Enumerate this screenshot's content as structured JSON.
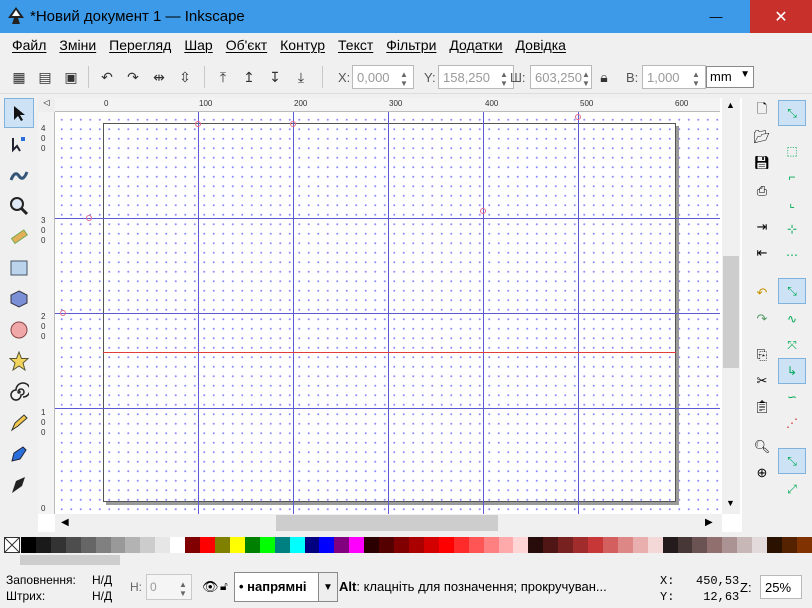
{
  "window": {
    "title": "*Новий документ 1 — Inkscape",
    "close_icon": "✕",
    "max_icon": "□",
    "min_icon": "—"
  },
  "menu": [
    {
      "label": "Файл"
    },
    {
      "label": "Зміни"
    },
    {
      "label": "Перегляд"
    },
    {
      "label": "Шар"
    },
    {
      "label": "Об'єкт"
    },
    {
      "label": "Контур"
    },
    {
      "label": "Текст"
    },
    {
      "label": "Фільтри"
    },
    {
      "label": "Додатки"
    },
    {
      "label": "Довідка"
    }
  ],
  "toolbar": {
    "x_label": "X:",
    "x_value": "0,000",
    "y_label": "Y:",
    "y_value": "158,250",
    "w_label": "Ш:",
    "w_value": "603,250",
    "h_label": "В:",
    "h_value": "1,000",
    "unit": "mm"
  },
  "ruler": {
    "top": [
      "0",
      "100",
      "200",
      "300",
      "400",
      "500",
      "600"
    ],
    "left": [
      "4",
      "0",
      "0",
      "3",
      "0",
      "0",
      "2",
      "0",
      "0",
      "1",
      "0",
      "0",
      "0"
    ]
  },
  "status": {
    "fill_label": "Заповнення:",
    "fill_value": "Н/Д",
    "stroke_label": "Штрих:",
    "stroke_value": "Н/Д",
    "h_label": "Н:",
    "h_value": "0",
    "layer": "напрямні",
    "message_key": "Alt",
    "message": ": клацніть для позначення; прокручуван...",
    "x_label": "X:",
    "x_value": "450,53",
    "y_label": "Y:",
    "y_value": "12,63",
    "zoom_label": "Z:",
    "zoom_value": "25%"
  },
  "colors": {
    "accent": "#3c9ae8",
    "close": "#c7302b",
    "guide": "#5b5bd6",
    "guide_selected": "#e43b3b"
  },
  "palette": [
    "#000000",
    "#1a1a1a",
    "#333333",
    "#4d4d4d",
    "#666666",
    "#808080",
    "#999999",
    "#b3b3b3",
    "#cccccc",
    "#e6e6e6",
    "#ffffff",
    "#800000",
    "#ff0000",
    "#808000",
    "#ffff00",
    "#008000",
    "#00ff00",
    "#008080",
    "#00ffff",
    "#000080",
    "#0000ff",
    "#800080",
    "#ff00ff",
    "#2b0000",
    "#550000",
    "#800000",
    "#aa0000",
    "#d40000",
    "#ff0000",
    "#ff2a2a",
    "#ff5555",
    "#ff8080",
    "#ffaaaa",
    "#ffd5d5",
    "#280b0b",
    "#501616",
    "#782121",
    "#a02c2c",
    "#c83737",
    "#d35f5f",
    "#de8787",
    "#e9afaf",
    "#f4d7d7",
    "#241c1c",
    "#483737",
    "#6c5353",
    "#916f6f",
    "#ac9393",
    "#c8b7b7",
    "#e3dbdb",
    "#2b1100",
    "#552200",
    "#803300"
  ]
}
